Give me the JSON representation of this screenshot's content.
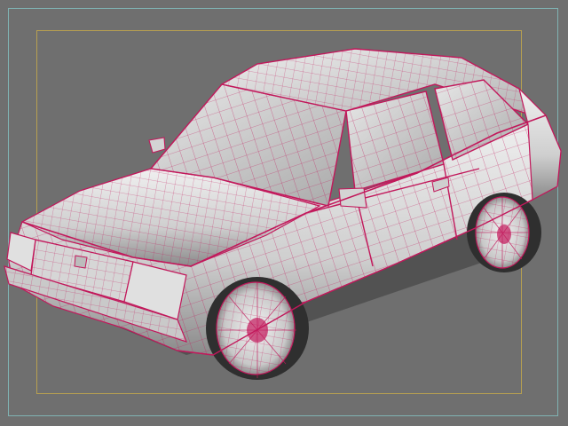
{
  "viewport": {
    "background": "#6f6f6f",
    "safe_frame_color": "#7fb3b3",
    "action_frame_color": "#b8a050",
    "wire_color": "#c2185b"
  },
  "model": {
    "icon": "car-wireframe-icon",
    "body_color": "#d9d9d9",
    "shadow_color": "#2e2e2e"
  }
}
